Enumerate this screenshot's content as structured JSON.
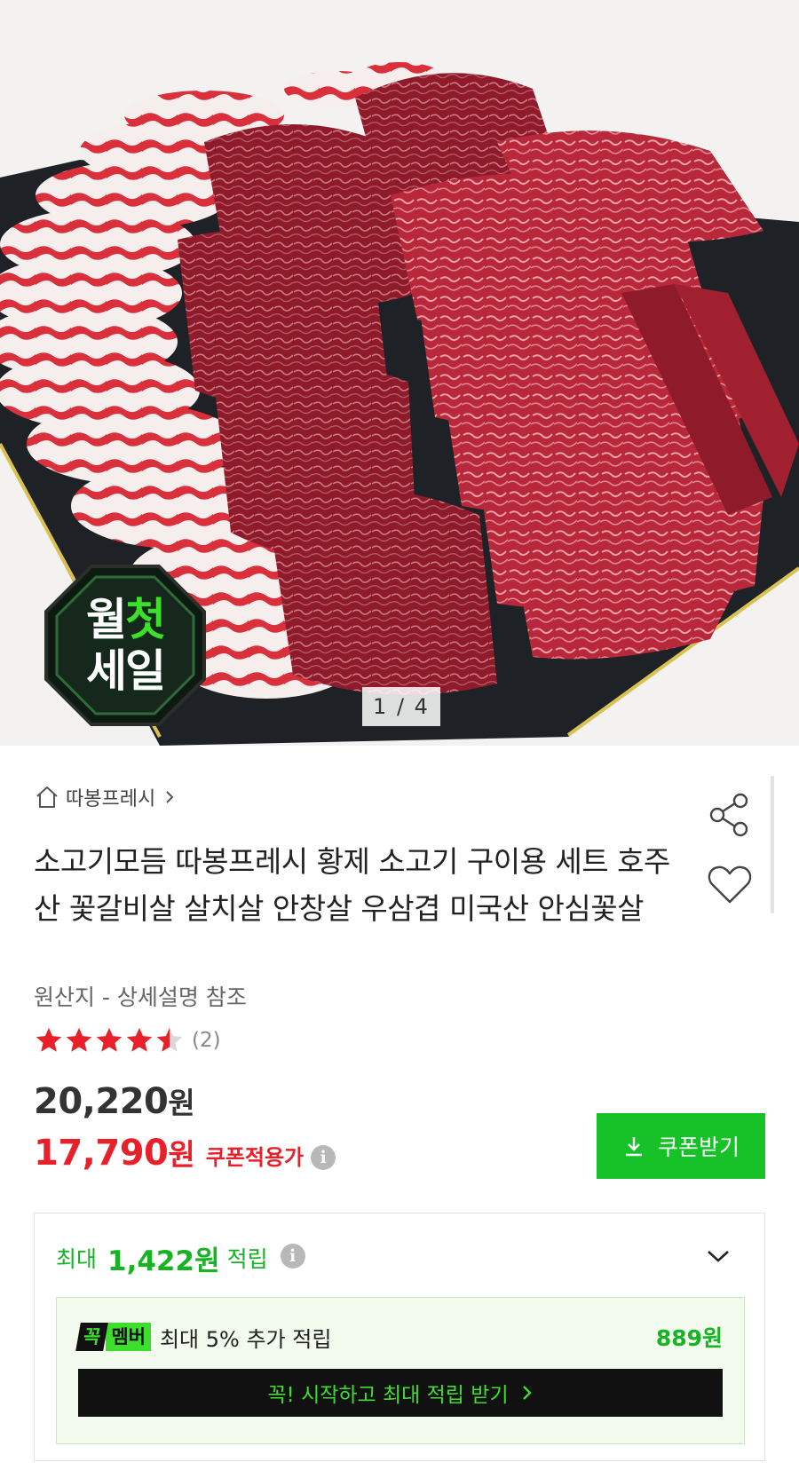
{
  "gallery": {
    "badge_line1_a": "월",
    "badge_line1_b": "첫",
    "badge_line2": "세일",
    "pager": "1 / 4"
  },
  "product": {
    "store_name": "따봉프레시",
    "title": "소고기모듬 따봉프레시 황제 소고기 구이용 세트 호주산 꽃갈비살 살치살 안창살 우삼겹 미국산 안심꽃살",
    "origin": "원산지 - 상세설명 참조",
    "rating_value": 4.5,
    "rating_count": "(2)",
    "original_price": "20,220",
    "sale_price": "17,790",
    "currency": "원",
    "coupon_price_label": "쿠폰적용가",
    "coupon_button": "쿠폰받기"
  },
  "points": {
    "prefix": "최대",
    "amount": "1,422원",
    "suffix": "적립",
    "member_badge_1": "꼭",
    "member_badge_2": "멤버",
    "member_text": "최대 5% 추가 적립",
    "member_bonus": "889원",
    "member_cta": "꼭! 시작하고 최대 적립 받기"
  },
  "icons": [
    "home-icon",
    "chevron-right-icon",
    "share-icon",
    "heart-icon",
    "star-icon",
    "info-icon",
    "download-icon",
    "chevron-down-icon"
  ],
  "colors": {
    "sale_red": "#e8202a",
    "naver_green": "#17c228",
    "points_green": "#17b324",
    "member_green": "#3ede2c"
  }
}
